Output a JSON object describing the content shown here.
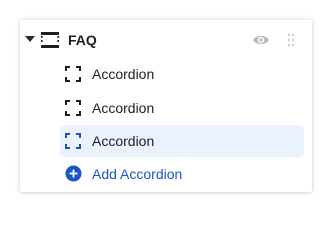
{
  "section": {
    "title": "FAQ",
    "icon": "section-frame-icon",
    "visibility_icon": "eye-icon",
    "drag_icon": "drag-handle-icon"
  },
  "items": [
    {
      "label": "Accordion",
      "icon": "accordion-frame-icon",
      "selected": false
    },
    {
      "label": "Accordion",
      "icon": "accordion-frame-icon",
      "selected": false
    },
    {
      "label": "Accordion",
      "icon": "accordion-frame-icon",
      "selected": true
    }
  ],
  "add": {
    "label": "Add Accordion",
    "icon": "plus-circle-icon"
  },
  "colors": {
    "accent": "#1a55c7",
    "selected_bg": "#eaf2fd",
    "icon_muted": "#b8bcc2",
    "text": "#1f1f23"
  }
}
